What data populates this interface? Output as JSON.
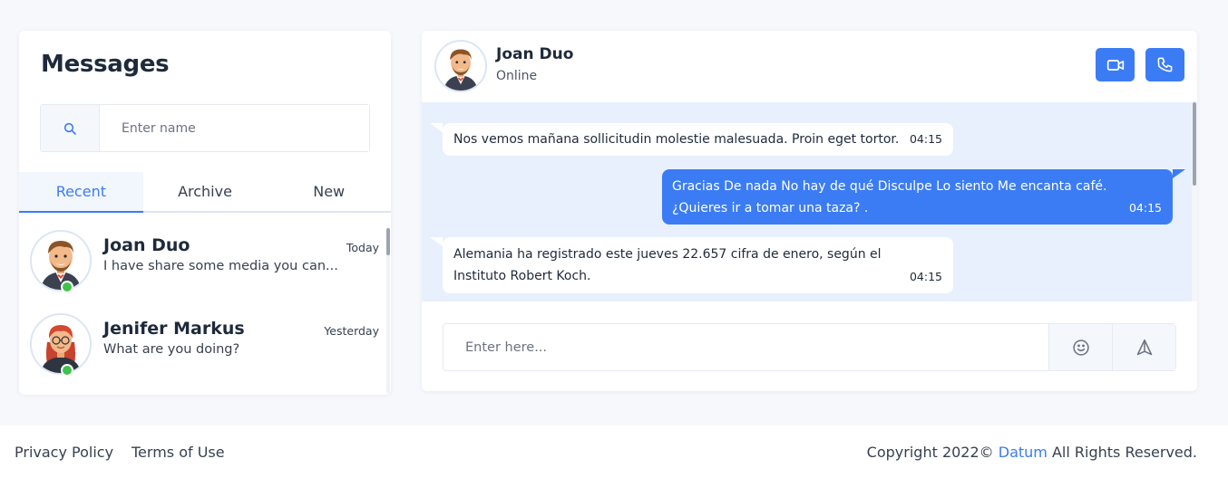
{
  "sidebar": {
    "title": "Messages",
    "search": {
      "placeholder": "Enter name",
      "value": ""
    },
    "tabs": [
      {
        "label": "Recent",
        "active": true
      },
      {
        "label": "Archive",
        "active": false
      },
      {
        "label": "New",
        "active": false
      }
    ],
    "contacts": [
      {
        "name": "Joan Duo",
        "time": "Today",
        "preview": "I have share some media you can...",
        "online": true,
        "avatar_icon": "male-avatar-icon"
      },
      {
        "name": "Jenifer Markus",
        "time": "Yesterday",
        "preview": "What are you doing?",
        "online": true,
        "avatar_icon": "female-avatar-icon"
      }
    ]
  },
  "chat": {
    "header": {
      "name": "Joan Duo",
      "status": "Online",
      "video_icon": "video-icon",
      "call_icon": "phone-icon"
    },
    "messages": [
      {
        "direction": "in",
        "text": "Nos vemos mañana sollicitudin molestie malesuada. Proin eget tortor.",
        "time": "04:15"
      },
      {
        "direction": "out",
        "text": "Gracias De nada No hay de qué Disculpe Lo siento Me encanta café. ¿Quieres ir a tomar una taza? .",
        "time": "04:15"
      },
      {
        "direction": "in",
        "text": "Alemania ha registrado este jueves 22.657 cifra de enero, según el Instituto Robert Koch.",
        "time": "04:15"
      }
    ],
    "composer": {
      "placeholder": "Enter here...",
      "value": "",
      "emoji_icon": "smile-icon",
      "send_icon": "send-icon"
    }
  },
  "footer": {
    "privacy": "Privacy Policy",
    "terms": "Terms of Use",
    "copyright_prefix": "Copyright 2022©",
    "brand": "Datum",
    "copyright_suffix": "All Rights Reserved."
  },
  "colors": {
    "accent": "#3b7cf5",
    "online": "#3fc34b",
    "chat_bg": "#e8f0fd"
  }
}
